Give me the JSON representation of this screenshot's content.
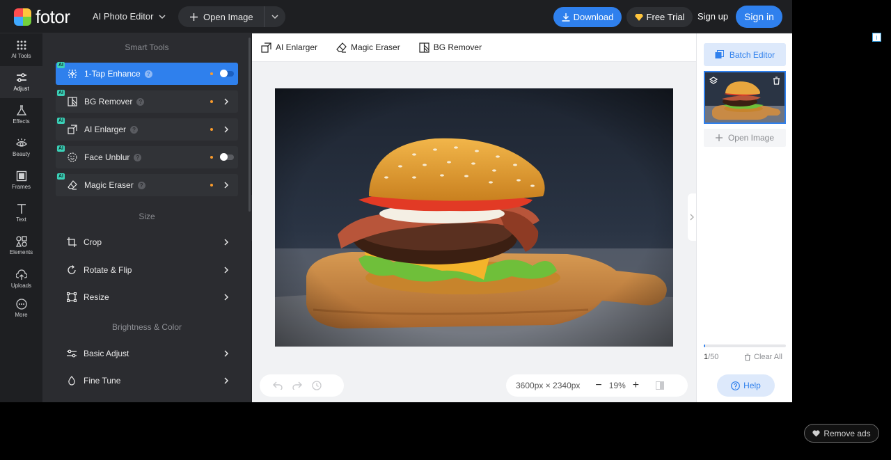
{
  "header": {
    "logo_text": "fotor",
    "app_switch_label": "AI Photo Editor",
    "open_image_label": "Open Image",
    "download_label": "Download",
    "free_trial_label": "Free Trial",
    "sign_up_label": "Sign up",
    "sign_in_label": "Sign in"
  },
  "rail": {
    "items": [
      {
        "label": "AI Tools",
        "icon": "grid-icon"
      },
      {
        "label": "Adjust",
        "icon": "sliders-icon"
      },
      {
        "label": "Effects",
        "icon": "flask-icon"
      },
      {
        "label": "Beauty",
        "icon": "eye-icon"
      },
      {
        "label": "Frames",
        "icon": "frame-icon"
      },
      {
        "label": "Text",
        "icon": "text-icon"
      },
      {
        "label": "Elements",
        "icon": "shapes-icon"
      },
      {
        "label": "Uploads",
        "icon": "upload-icon"
      },
      {
        "label": "More",
        "icon": "more-icon"
      }
    ],
    "active": "Adjust"
  },
  "panel": {
    "smart_tools_title": "Smart Tools",
    "smart_tools": [
      {
        "label": "1-Tap Enhance",
        "tag": "AI",
        "control": "toggle",
        "active": true
      },
      {
        "label": "BG Remover",
        "tag": "AI",
        "control": "chevron"
      },
      {
        "label": "AI Enlarger",
        "tag": "AI",
        "control": "chevron"
      },
      {
        "label": "Face Unblur",
        "tag": "AI",
        "control": "toggle"
      },
      {
        "label": "Magic Eraser",
        "tag": "AI",
        "control": "chevron"
      }
    ],
    "size_title": "Size",
    "size_tools": [
      {
        "label": "Crop"
      },
      {
        "label": "Rotate & Flip"
      },
      {
        "label": "Resize"
      }
    ],
    "brightness_title": "Brightness & Color",
    "brightness_tools": [
      {
        "label": "Basic Adjust"
      },
      {
        "label": "Fine Tune"
      }
    ]
  },
  "subbar": {
    "items": [
      {
        "label": "AI Enlarger"
      },
      {
        "label": "Magic Eraser"
      },
      {
        "label": "BG Remover"
      }
    ]
  },
  "canvas": {
    "dimensions": "3600px × 2340px",
    "zoom": "19%"
  },
  "right_panel": {
    "batch_editor_label": "Batch Editor",
    "open_image_label": "Open Image",
    "count_current": "1",
    "count_total": "/50",
    "progress_fraction": 0.02,
    "clear_all_label": "Clear All",
    "help_label": "Help"
  },
  "ads": {
    "remove_ads_label": "Remove ads",
    "adchoices_label": "i"
  },
  "colors": {
    "accent": "#2f80ed",
    "ai_tag": "#3bd1b8",
    "dot": "#fa9b2c"
  }
}
